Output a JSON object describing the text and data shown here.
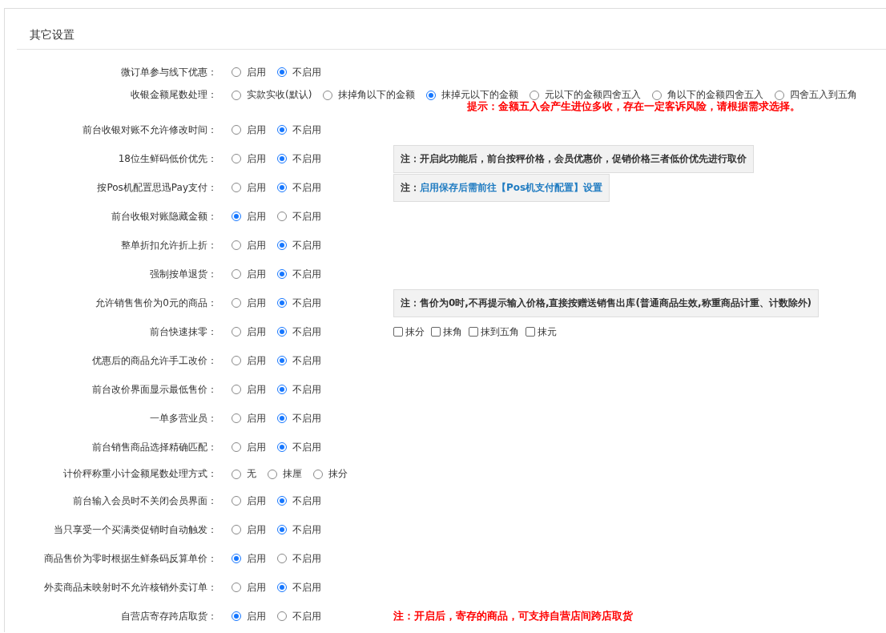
{
  "section": {
    "title": "其它设置"
  },
  "rows": [
    {
      "label": "微订单参与线下优惠：",
      "options": [
        {
          "label": "启用",
          "selected": false
        },
        {
          "label": "不启用",
          "selected": true
        }
      ]
    },
    {
      "label": "收银金额尾数处理：",
      "options": [
        {
          "label": "实款实收(默认)",
          "selected": false
        },
        {
          "label": "抹掉角以下的金额",
          "selected": false
        },
        {
          "label": "抹掉元以下的金额",
          "selected": true
        },
        {
          "label": "元以下的金额四舍五入",
          "selected": false
        },
        {
          "label": "角以下的金额四舍五入",
          "selected": false
        },
        {
          "label": "四舍五入到五角",
          "selected": false
        }
      ],
      "hint": "提示：金额五入会产生进位多收，存在一定客诉风险，请根据需求选择。"
    },
    {
      "label": "前台收银对账不允许修改时间：",
      "options": [
        {
          "label": "启用",
          "selected": false
        },
        {
          "label": "不启用",
          "selected": true
        }
      ]
    },
    {
      "label": "18位生鲜码低价优先：",
      "options": [
        {
          "label": "启用",
          "selected": false
        },
        {
          "label": "不启用",
          "selected": true
        }
      ],
      "extra": {
        "kind": "note",
        "prefix": "注：",
        "text": "开启此功能后，前台按秤价格，会员优惠价，促销价格三者低价优先进行取价"
      }
    },
    {
      "label": "按Pos机配置思迅Pay支付：",
      "options": [
        {
          "label": "启用",
          "selected": false
        },
        {
          "label": "不启用",
          "selected": true
        }
      ],
      "extra": {
        "kind": "link",
        "prefix": "注：",
        "text": "启用保存后需前往【Pos机支付配置】设置"
      }
    },
    {
      "label": "前台收银对账隐藏金额：",
      "options": [
        {
          "label": "启用",
          "selected": true
        },
        {
          "label": "不启用",
          "selected": false
        }
      ]
    },
    {
      "label": "整单折扣允许折上折：",
      "options": [
        {
          "label": "启用",
          "selected": false
        },
        {
          "label": "不启用",
          "selected": true
        }
      ]
    },
    {
      "label": "强制按单退货：",
      "options": [
        {
          "label": "启用",
          "selected": false
        },
        {
          "label": "不启用",
          "selected": true
        }
      ]
    },
    {
      "label": "允许销售售价为0元的商品：",
      "options": [
        {
          "label": "启用",
          "selected": false
        },
        {
          "label": "不启用",
          "selected": true
        }
      ],
      "extra": {
        "kind": "note",
        "prefix": "注：",
        "text": "售价为0时,不再提示输入价格,直接按赠送销售出库(普通商品生效,称重商品计重、计数除外)"
      }
    },
    {
      "label": "前台快速抹零：",
      "options": [
        {
          "label": "启用",
          "selected": false
        },
        {
          "label": "不启用",
          "selected": true
        }
      ],
      "extra": {
        "kind": "checkboxes",
        "items": [
          {
            "label": "抹分",
            "checked": false
          },
          {
            "label": "抹角",
            "checked": false
          },
          {
            "label": "抹到五角",
            "checked": false
          },
          {
            "label": "抹元",
            "checked": false
          }
        ]
      }
    },
    {
      "label": "优惠后的商品允许手工改价：",
      "options": [
        {
          "label": "启用",
          "selected": false
        },
        {
          "label": "不启用",
          "selected": true
        }
      ]
    },
    {
      "label": "前台改价界面显示最低售价：",
      "options": [
        {
          "label": "启用",
          "selected": false
        },
        {
          "label": "不启用",
          "selected": true
        }
      ]
    },
    {
      "label": "一单多营业员：",
      "options": [
        {
          "label": "启用",
          "selected": false
        },
        {
          "label": "不启用",
          "selected": true
        }
      ]
    },
    {
      "label": "前台销售商品选择精确匹配：",
      "options": [
        {
          "label": "启用",
          "selected": false
        },
        {
          "label": "不启用",
          "selected": true
        }
      ]
    },
    {
      "label": "计价秤称重小计金额尾数处理方式：",
      "options": [
        {
          "label": "无",
          "selected": false
        },
        {
          "label": "抹厘",
          "selected": false
        },
        {
          "label": "抹分",
          "selected": false
        }
      ]
    },
    {
      "label": "前台输入会员时不关闭会员界面：",
      "options": [
        {
          "label": "启用",
          "selected": false
        },
        {
          "label": "不启用",
          "selected": true
        }
      ]
    },
    {
      "label": "当只享受一个买满类促销时自动触发：",
      "options": [
        {
          "label": "启用",
          "selected": false
        },
        {
          "label": "不启用",
          "selected": true
        }
      ]
    },
    {
      "label": "商品售价为零时根据生鲜条码反算单价：",
      "options": [
        {
          "label": "启用",
          "selected": true
        },
        {
          "label": "不启用",
          "selected": false
        }
      ]
    },
    {
      "label": "外卖商品未映射时不允许核销外卖订单：",
      "options": [
        {
          "label": "启用",
          "selected": false
        },
        {
          "label": "不启用",
          "selected": true
        }
      ]
    },
    {
      "label": "自营店寄存跨店取货：",
      "options": [
        {
          "label": "启用",
          "selected": true
        },
        {
          "label": "不启用",
          "selected": false
        }
      ],
      "extra": {
        "kind": "alert",
        "prefix": "注：",
        "text": "开启后，寄存的商品，可支持自营店间跨店取货"
      }
    }
  ]
}
